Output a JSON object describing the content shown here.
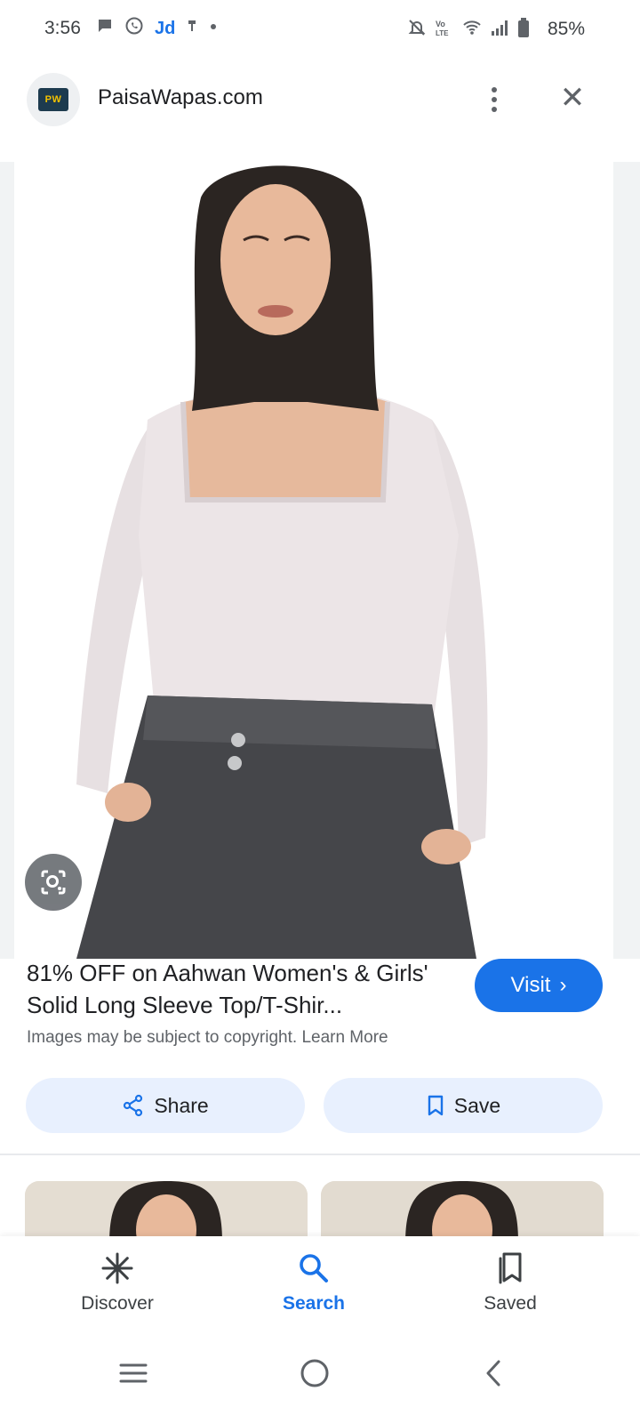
{
  "status_bar": {
    "time": "3:56",
    "left_icons": [
      "chat-bubble-icon",
      "whatsapp-icon",
      "jd-app-icon",
      "usb-icon",
      "dot-icon"
    ],
    "jd_label": "Jd",
    "battery": "85%",
    "right_icons": [
      "mute-notification-icon",
      "volte-icon",
      "wifi-icon",
      "signal-icon",
      "battery-icon"
    ]
  },
  "header": {
    "site_name": "PaisaWapas.com",
    "logo_text": "PW",
    "more_icon": "more-vert-icon",
    "close_icon": "close-icon",
    "close_glyph": "✕"
  },
  "result": {
    "title": "81% OFF on Aahwan Women's & Girls' Solid Long Sleeve Top/T-Shir...",
    "visit_label": "Visit",
    "visit_chevron": "›",
    "copyright_text": "Images may be subject to copyright.",
    "learn_more": "Learn More"
  },
  "actions": {
    "share_label": "Share",
    "save_label": "Save"
  },
  "bottom_nav": {
    "items": [
      {
        "label": "Discover",
        "icon": "asterisk-icon"
      },
      {
        "label": "Search",
        "icon": "search-icon",
        "active": true
      },
      {
        "label": "Saved",
        "icon": "bookmarks-icon"
      }
    ]
  },
  "system_nav": [
    "recents-icon",
    "home-icon",
    "back-icon"
  ],
  "colors": {
    "accent": "#1a73e8",
    "pill_bg": "#e8f0fe",
    "text_secondary": "#5f6368"
  }
}
